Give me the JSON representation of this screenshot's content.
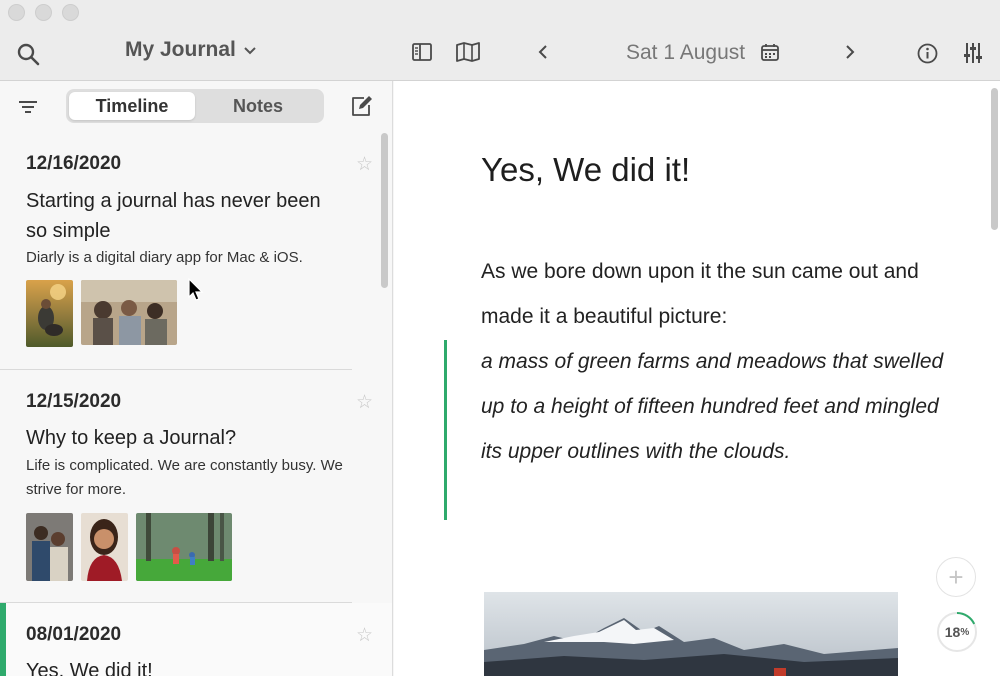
{
  "toolbar": {
    "journal_title": "My Journal",
    "date_title": "Sat 1 August"
  },
  "sidebar": {
    "tabs": [
      {
        "label": "Timeline",
        "active": true
      },
      {
        "label": "Notes",
        "active": false
      }
    ],
    "entries": [
      {
        "date": "12/16/2020",
        "title": "Starting a journal has never been so simple",
        "snippet": "Diarly is a digital diary app for Mac & iOS.",
        "starred": false,
        "thumbnails": [
          "person-with-dog-photo",
          "friends-in-field-photo"
        ]
      },
      {
        "date": "12/15/2020",
        "title": "Why to keep a Journal?",
        "snippet": "Life is complicated. We are constantly busy. We strive for more.",
        "starred": false,
        "thumbnails": [
          "family-photo",
          "smiling-woman-photo",
          "children-in-forest-photo"
        ]
      },
      {
        "date": "08/01/2020",
        "title": "Yes, We did it!",
        "starred": false,
        "selected": true
      }
    ]
  },
  "editor": {
    "title": "Yes, We did it!",
    "paragraph": "As we bore down upon it the sun came out and made it a beautiful picture:",
    "quote": "a mass of green farms and meadows that swelled up to a height of fifteen hundred feet and mingled its upper outlines with the clouds.",
    "image": "mountain-landscape-photo",
    "add_button": "+",
    "progress_value": "18",
    "progress_unit": "%",
    "progress_fraction": 0.18
  },
  "colors": {
    "accent": "#2faa6c",
    "toolbar_bg": "#ececec",
    "sidebar_bg": "#f7f7f7",
    "editor_bg": "#ffffff"
  }
}
